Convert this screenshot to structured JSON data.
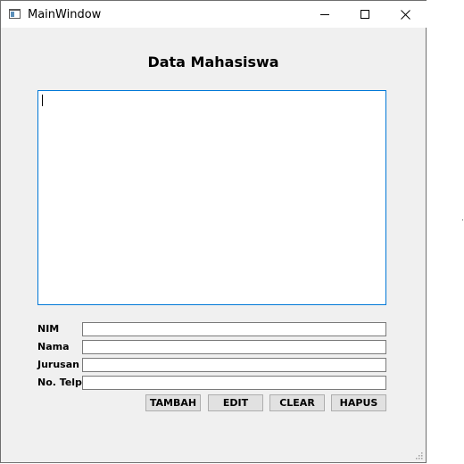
{
  "window": {
    "title": "MainWindow",
    "icon": "window-app-icon"
  },
  "caption_buttons": {
    "minimize_icon": "minimize-icon",
    "maximize_icon": "maximize-icon",
    "close_icon": "close-icon"
  },
  "main": {
    "heading": "Data Mahasiswa",
    "output_text": ""
  },
  "form": {
    "fields": [
      {
        "label": "NIM",
        "value": ""
      },
      {
        "label": "Nama",
        "value": ""
      },
      {
        "label": "Jurusan",
        "value": ""
      },
      {
        "label": "No. Telp",
        "value": ""
      }
    ]
  },
  "buttons": {
    "add_label": "TAMBAH",
    "edit_label": "EDIT",
    "clear_label": "CLEAR",
    "delete_label": "HAPUS"
  },
  "colors": {
    "focus_border": "#0078d7",
    "window_background": "#f0f0f0",
    "button_background": "#e1e1e1"
  }
}
